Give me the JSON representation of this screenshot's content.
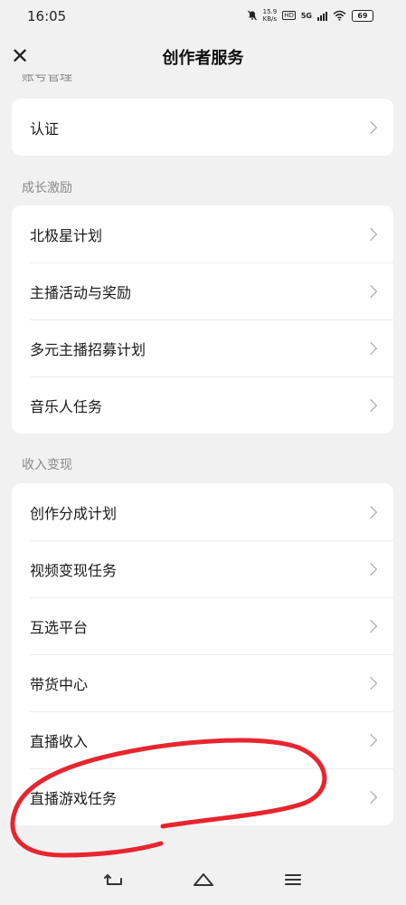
{
  "status_bar": {
    "time": "16:05",
    "net_speed_top": "15.9",
    "net_speed_bottom": "KB/s",
    "hd": "HD",
    "net_type": "5G",
    "battery": "69"
  },
  "header": {
    "title": "创作者服务",
    "close_icon": "close-icon"
  },
  "sections": {
    "account": {
      "label": "账号管理",
      "items": [
        "认证"
      ]
    },
    "growth": {
      "label": "成长激励",
      "items": [
        "北极星计划",
        "主播活动与奖励",
        "多元主播招募计划",
        "音乐人任务"
      ]
    },
    "monetize": {
      "label": "收入变现",
      "items": [
        "创作分成计划",
        "视频变现任务",
        "互选平台",
        "带货中心",
        "直播收入",
        "直播游戏任务"
      ]
    }
  },
  "nav": {
    "back_icon": "back-icon",
    "home_icon": "home-icon",
    "menu_icon": "menu-icon"
  },
  "colors": {
    "background": "#f1f1f1",
    "card": "#ffffff",
    "annotation": "#e8252e",
    "section_label": "#8a8a8a"
  }
}
